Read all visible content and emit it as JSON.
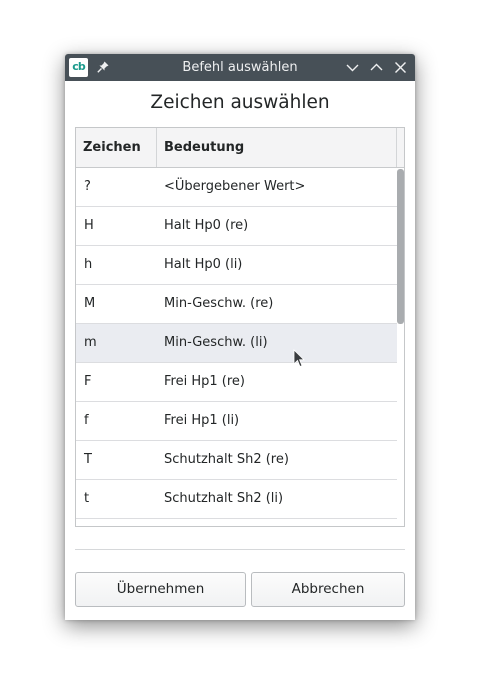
{
  "window": {
    "title": "Befehl auswählen",
    "app_icon_glyph": "cb",
    "accent_color": "#1a9a8c",
    "titlebar_color": "#475057"
  },
  "dialog": {
    "heading": "Zeichen auswählen"
  },
  "table": {
    "columns": [
      "Zeichen",
      "Bedeutung"
    ],
    "rows": [
      {
        "zeichen": "?",
        "bedeutung": "<Übergebener Wert>"
      },
      {
        "zeichen": "H",
        "bedeutung": "Halt Hp0 (re)"
      },
      {
        "zeichen": "h",
        "bedeutung": "Halt Hp0 (li)"
      },
      {
        "zeichen": "M",
        "bedeutung": "Min-Geschw. (re)"
      },
      {
        "zeichen": "m",
        "bedeutung": "Min-Geschw. (li)"
      },
      {
        "zeichen": "F",
        "bedeutung": "Frei Hp1 (re)"
      },
      {
        "zeichen": "f",
        "bedeutung": "Frei Hp1 (li)"
      },
      {
        "zeichen": "T",
        "bedeutung": "Schutzhalt Sh2 (re)"
      },
      {
        "zeichen": "t",
        "bedeutung": "Schutzhalt Sh2 (li)"
      },
      {
        "zeichen": "",
        "bedeutung": ""
      }
    ],
    "hovered_row": 4
  },
  "buttons": {
    "ok_label": "Übernehmen",
    "cancel_label": "Abbrechen"
  },
  "icons": {
    "pin": "pin-icon",
    "minimize": "chevron-down-icon",
    "maximize": "chevron-up-icon",
    "close": "close-icon"
  }
}
